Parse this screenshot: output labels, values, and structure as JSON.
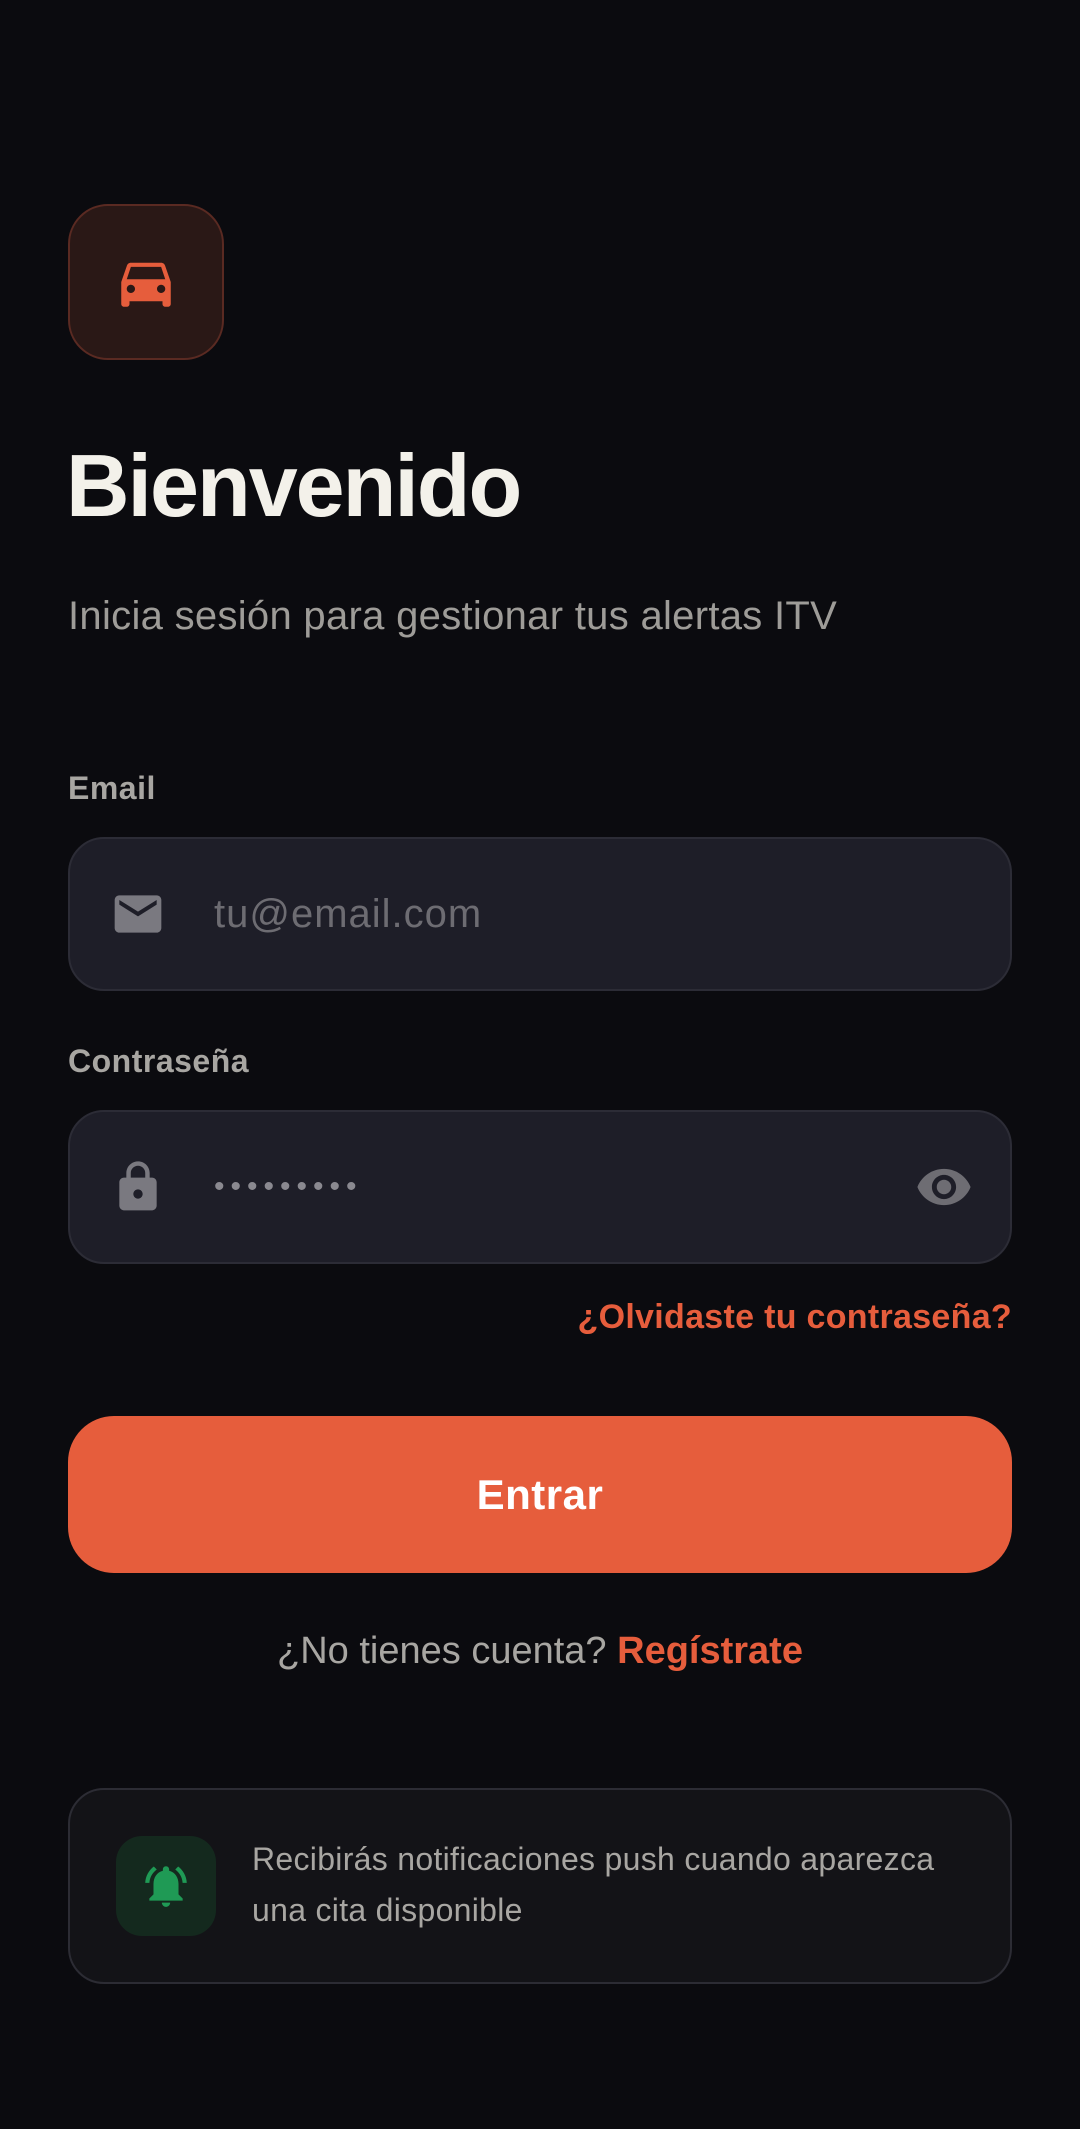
{
  "app": {
    "logo_icon": "car-icon",
    "accent_color": "#e65d3c"
  },
  "header": {
    "title": "Bienvenido",
    "subtitle": "Inicia sesión para gestionar tus alertas ITV"
  },
  "form": {
    "email": {
      "label": "Email",
      "placeholder": "tu@email.com",
      "icon": "mail-icon"
    },
    "password": {
      "label": "Contraseña",
      "masked_value": "•••••••••",
      "icon": "lock-icon",
      "toggle_icon": "eye-icon"
    },
    "forgot_password": "¿Olvidaste tu contraseña?",
    "submit_label": "Entrar"
  },
  "signup": {
    "prompt": "¿No tienes cuenta?",
    "link": "Regístrate"
  },
  "info": {
    "icon": "bell-ringing-icon",
    "icon_color": "#1f9a55",
    "text": "Recibirás notificaciones push cuando aparezca una cita disponible"
  }
}
